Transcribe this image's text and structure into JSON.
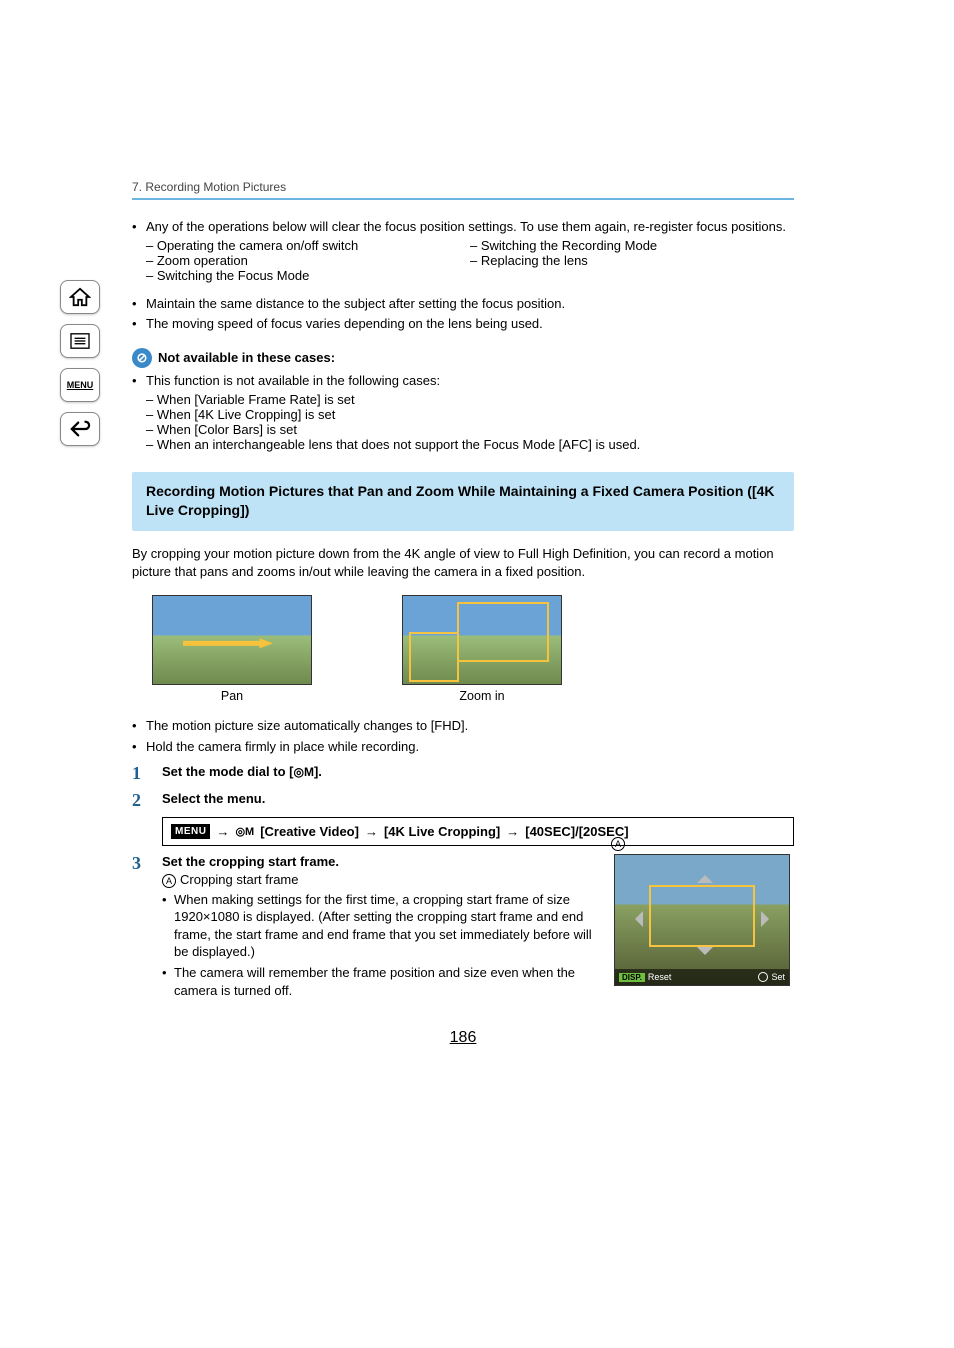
{
  "breadcrumb": "7. Recording Motion Pictures",
  "intro_bullet": "Any of the operations below will clear the focus position settings. To use them again, re-register focus positions.",
  "clear_ops": {
    "left": [
      "Operating the camera on/off switch",
      "Zoom operation",
      "Switching the Focus Mode"
    ],
    "right": [
      "Switching the Recording Mode",
      "Replacing the lens"
    ]
  },
  "notes": [
    "Maintain the same distance to the subject after setting the focus position.",
    "The moving speed of focus varies depending on the lens being used."
  ],
  "not_available": {
    "title": "Not available in these cases:",
    "lead": "This function is not available in the following cases:",
    "items": [
      "When [Variable Frame Rate] is set",
      "When [4K Live Cropping] is set",
      "When [Color Bars] is set",
      "When an interchangeable lens that does not support the Focus Mode [AFC] is used."
    ]
  },
  "section_title": "Recording Motion Pictures that Pan and Zoom While Maintaining a Fixed Camera Position ([4K Live Cropping])",
  "section_body": "By cropping your motion picture down from the 4K angle of view to Full High Definition, you can record a motion picture that pans and zooms in/out while leaving the camera in a fixed position.",
  "thumb_captions": {
    "pan": "Pan",
    "zoom": "Zoom in"
  },
  "post_img_bullets": [
    "The motion picture size automatically changes to [FHD].",
    "Hold the camera firmly in place while recording."
  ],
  "steps": {
    "1": {
      "label": "Set the mode dial to [",
      "suffix": "]."
    },
    "2": {
      "label": "Select the menu."
    },
    "3": {
      "label": "Set the cropping start frame.",
      "sub_a": "Cropping start frame",
      "sub1": "When making settings for the first time, a cropping start frame of size 1920×1080 is displayed. (After setting the cropping start frame and end frame, the start frame and end frame that you set immediately before will be displayed.)",
      "sub2": "The camera will remember the frame position and size even when the camera is turned off."
    }
  },
  "menu_path": {
    "badge": "MENU",
    "group": "[Creative Video]",
    "item": "[4K Live Cropping]",
    "values": "[40SEC]/[20SEC]"
  },
  "crop_img": {
    "a": "A",
    "disp": "DISP.",
    "reset": "Reset",
    "set": "Set"
  },
  "page_number": "186"
}
